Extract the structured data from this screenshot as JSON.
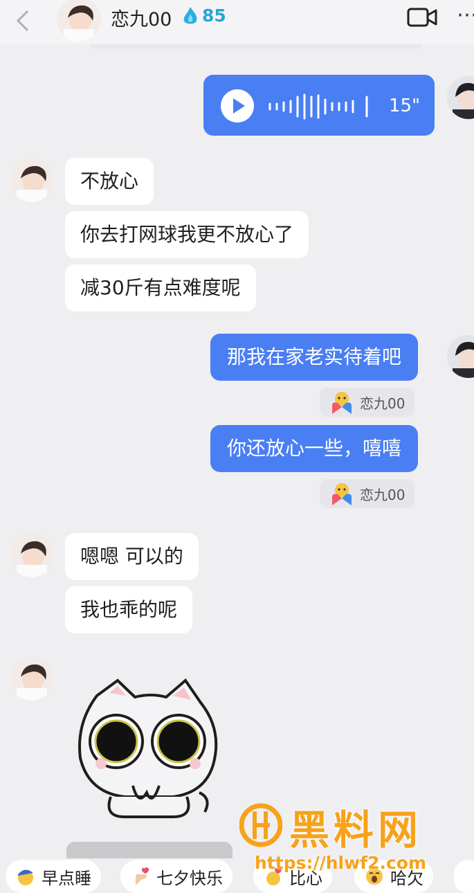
{
  "header": {
    "back_icon": "chevron-left-icon",
    "contact_name": "恋九00",
    "intimacy_icon": "water-drop-icon",
    "intimacy_score": "85",
    "video_icon": "video-camera-icon",
    "more_icon": "more-dots-icon"
  },
  "messages": {
    "voice": {
      "duration": "15\"",
      "play_icon": "play-icon"
    },
    "in1": "不放心",
    "in2": "你去打网球我更不放心了",
    "in3": "减30斤有点难度呢",
    "out1": "那我在家老实待着吧",
    "out1_reaction": "恋九00",
    "out2": "你还放心一些，嘻嘻",
    "out2_reaction": "恋九00",
    "in4": "嗯嗯 可以的",
    "in5": "我也乖的呢",
    "sticker": "cat-sticker"
  },
  "quick_replies": [
    "早点睡",
    "七夕快乐",
    "比心",
    "哈欠"
  ],
  "watermark": {
    "text": "黑料网",
    "url": "https://hlwf2.com"
  },
  "colors": {
    "outgoing": "#4a7ef3",
    "incoming": "#ffffff",
    "background": "#efeff1",
    "watermark": "#f7a21b"
  }
}
